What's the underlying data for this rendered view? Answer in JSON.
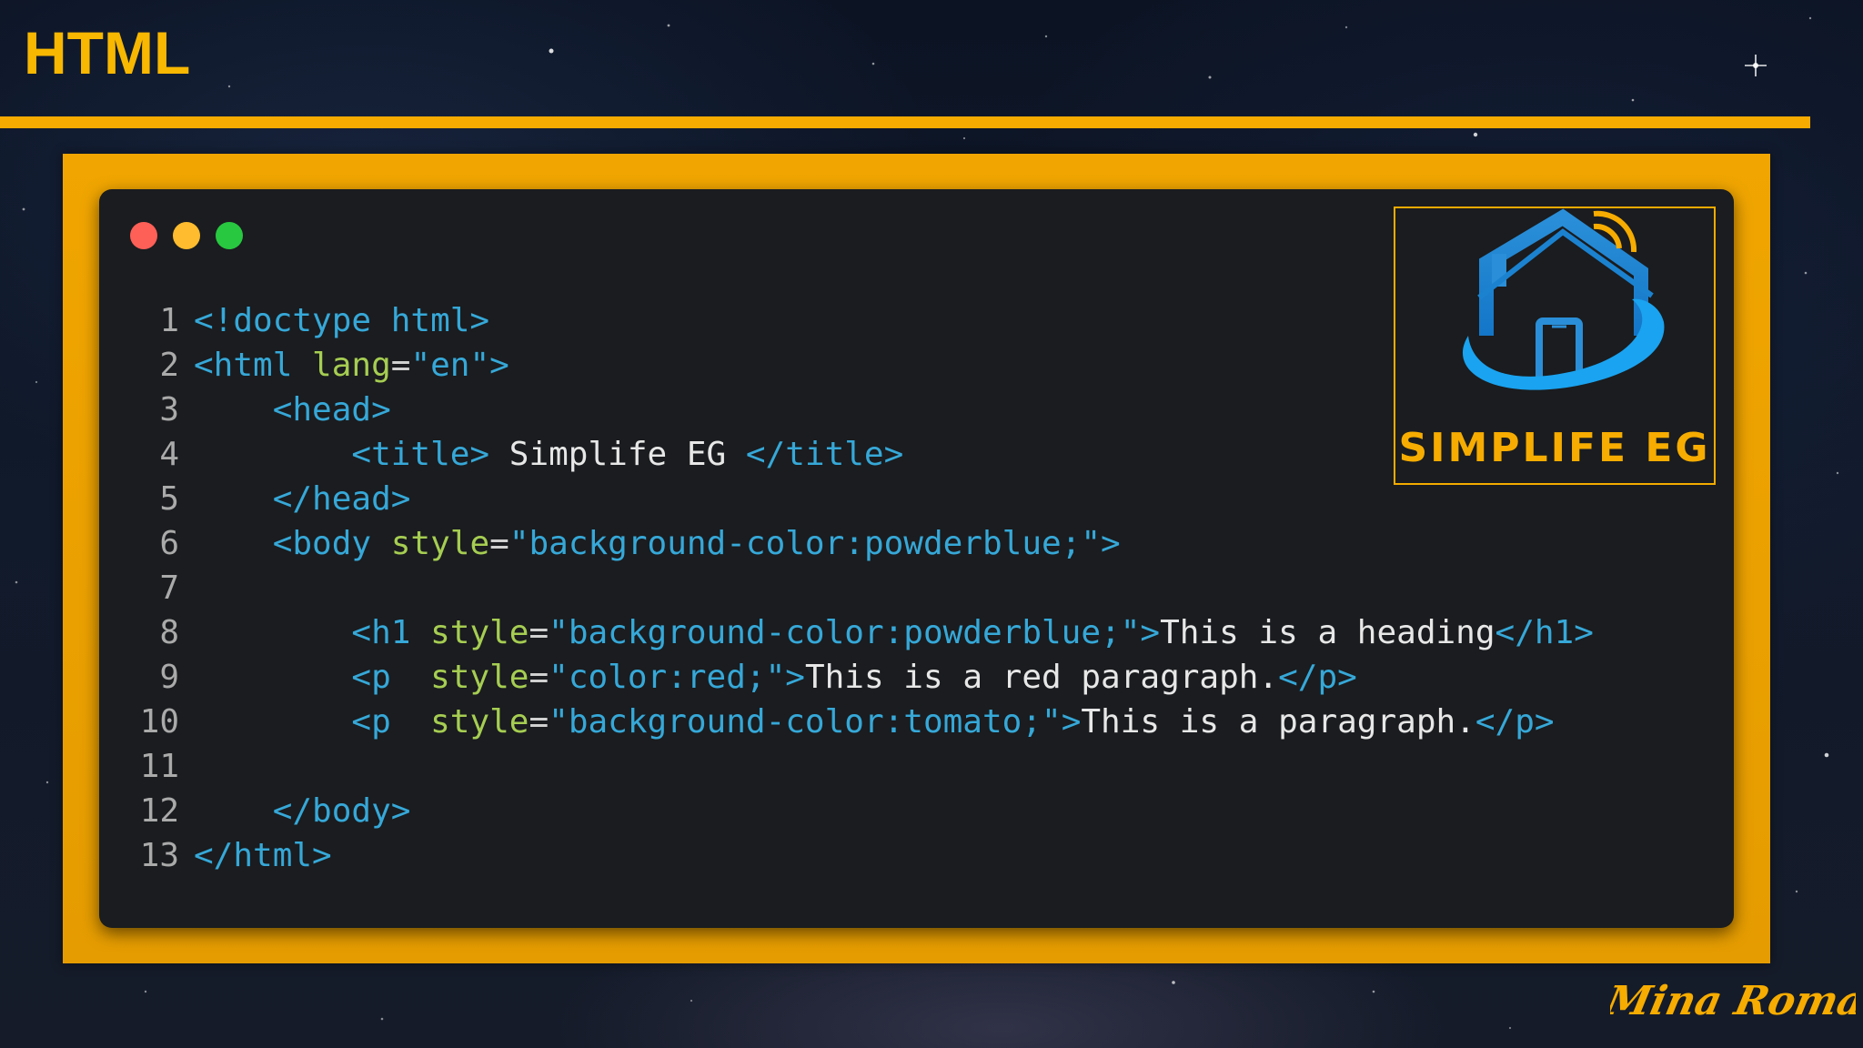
{
  "slide": {
    "title": "HTML",
    "accent_color": "#f5ab00"
  },
  "editor": {
    "window_controls": [
      "close-dot",
      "minimize-dot",
      "maximize-dot"
    ],
    "lines": [
      {
        "n": "1",
        "tokens": [
          [
            "t",
            "<!doctype html>"
          ]
        ]
      },
      {
        "n": "2",
        "tokens": [
          [
            "t",
            "<html "
          ],
          [
            "a",
            "lang"
          ],
          [
            "p",
            "="
          ],
          [
            "s",
            "\"en\""
          ],
          [
            "t",
            ">"
          ]
        ]
      },
      {
        "n": "3",
        "tokens": [
          [
            "t",
            "    <head>"
          ]
        ]
      },
      {
        "n": "4",
        "tokens": [
          [
            "t",
            "        <title>"
          ],
          [
            "x",
            " Simplife EG "
          ],
          [
            "t",
            "</title>"
          ]
        ]
      },
      {
        "n": "5",
        "tokens": [
          [
            "t",
            "    </head>"
          ]
        ]
      },
      {
        "n": "6",
        "tokens": [
          [
            "t",
            "    <body "
          ],
          [
            "a",
            "style"
          ],
          [
            "p",
            "="
          ],
          [
            "s",
            "\"background-color:powderblue;\""
          ],
          [
            "t",
            ">"
          ]
        ]
      },
      {
        "n": "7",
        "tokens": []
      },
      {
        "n": "8",
        "tokens": [
          [
            "t",
            "        <h1 "
          ],
          [
            "a",
            "style"
          ],
          [
            "p",
            "="
          ],
          [
            "s",
            "\"background-color:powderblue;\""
          ],
          [
            "t",
            ">"
          ],
          [
            "x",
            "This is a heading"
          ],
          [
            "t",
            "</h1>"
          ]
        ]
      },
      {
        "n": "9",
        "tokens": [
          [
            "t",
            "        <p  "
          ],
          [
            "a",
            "style"
          ],
          [
            "p",
            "="
          ],
          [
            "s",
            "\"color:red;\""
          ],
          [
            "t",
            ">"
          ],
          [
            "x",
            "This is a red paragraph."
          ],
          [
            "t",
            "</p>"
          ]
        ]
      },
      {
        "n": "10",
        "tokens": [
          [
            "t",
            "        <p  "
          ],
          [
            "a",
            "style"
          ],
          [
            "p",
            "="
          ],
          [
            "s",
            "\"background-color:tomato;\""
          ],
          [
            "t",
            ">"
          ],
          [
            "x",
            "This is a paragraph."
          ],
          [
            "t",
            "</p>"
          ]
        ]
      },
      {
        "n": "11",
        "tokens": []
      },
      {
        "n": "12",
        "tokens": [
          [
            "t",
            "    </body>"
          ]
        ]
      },
      {
        "n": "13",
        "tokens": [
          [
            "t",
            "</html>"
          ]
        ]
      }
    ]
  },
  "logo": {
    "text": "SIMPLIFE EG",
    "icon": "smart-home-icon"
  },
  "signature": {
    "text": "Mina Romany"
  }
}
